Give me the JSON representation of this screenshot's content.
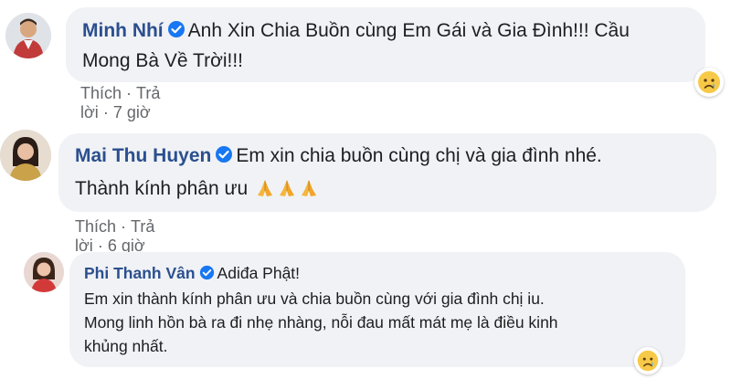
{
  "comments": [
    {
      "author": "Minh Nhí",
      "text_lines": [
        "Anh Xin Chia Buồn cùng Em Gái và Gia Đình!!! Cầu",
        "Mong Bà Về Trời!!!"
      ],
      "actions": {
        "like": "Thích",
        "reply": "Trả lời",
        "sep": "·",
        "time": "7 giờ"
      },
      "reaction": "crying-face"
    },
    {
      "author": "Mai Thu Huyen",
      "text_lines": [
        "Em xin chia buồn cùng chị và gia đình nhé.",
        "Thành kính phân ưu"
      ],
      "actions": {
        "like": "Thích",
        "reply": "Trả lời",
        "sep": "·",
        "time": "6 giờ"
      }
    },
    {
      "author": "Phi Thanh Vân",
      "text_lines": [
        "Adiđa Phật!",
        "Em xin thành kính phân ưu và chia buồn cùng với gia đình chị iu.",
        "Mong linh hồn bà ra đi nhẹ nhàng, nỗi đau mất mát mẹ là điều kinh",
        "khủng nhất."
      ],
      "reaction": "crying-face"
    }
  ],
  "colors": {
    "author": "#2b4f8f",
    "bubble": "#f0f2f5",
    "verified": "#1877f2",
    "meta": "#65676b"
  }
}
